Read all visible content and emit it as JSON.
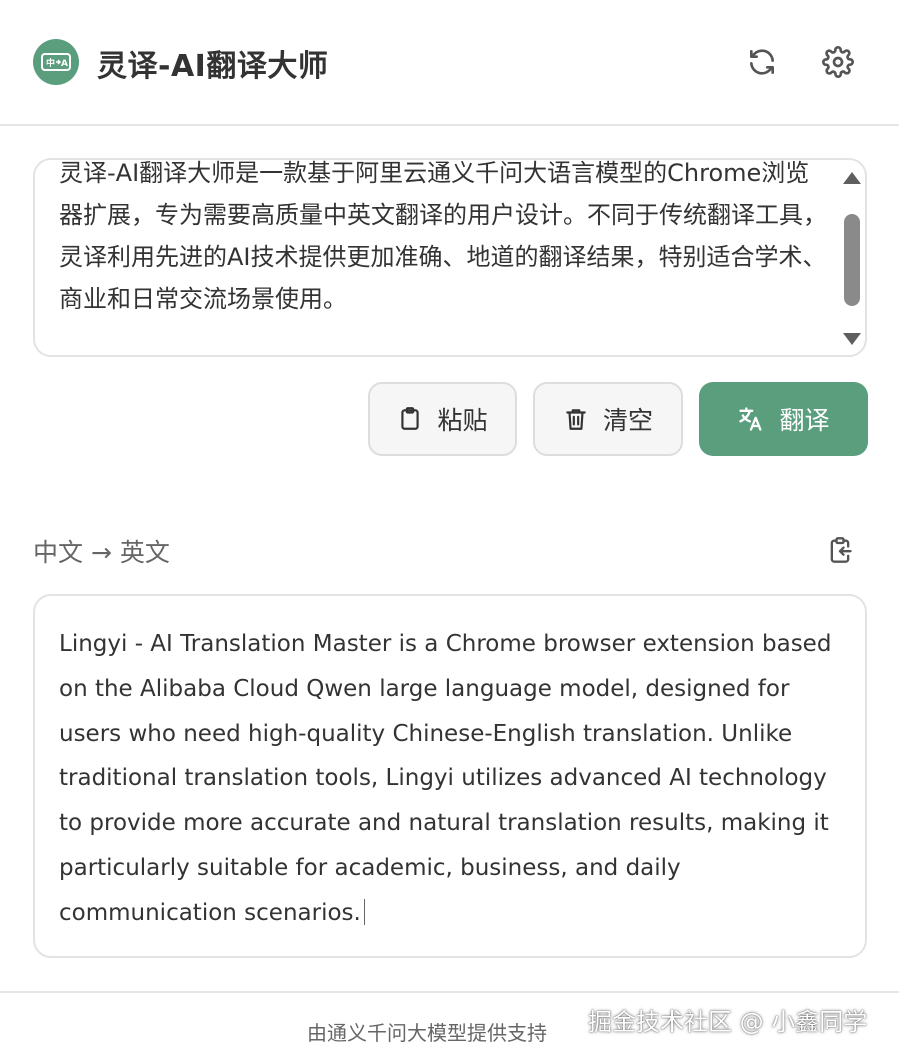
{
  "header": {
    "title": "灵译-AI翻译大师",
    "logo_icon": "translate-logo-icon",
    "refresh_icon": "refresh-icon",
    "settings_icon": "gear-icon"
  },
  "input": {
    "text": "灵译-AI翻译大师是一款基于阿里云通义千问大语言模型的Chrome浏览器扩展，专为需要高质量中英文翻译的用户设计。不同于传统翻译工具，灵译利用先进的AI技术提供更加准确、地道的翻译结果，特别适合学术、商业和日常交流场景使用。"
  },
  "actions": {
    "paste_label": "粘贴",
    "clear_label": "清空",
    "translate_label": "翻译"
  },
  "result": {
    "direction": "中文 → 英文",
    "copy_icon": "clipboard-copy-icon",
    "text": "Lingyi - AI Translation Master is a Chrome browser extension based on the Alibaba Cloud Qwen large language model, designed for users who need high-quality Chinese-English translation. Unlike traditional translation tools, Lingyi utilizes advanced AI technology to provide more accurate and natural translation results, making it particularly suitable for academic, business, and daily communication scenarios."
  },
  "footer": {
    "text": "由通义千问大模型提供支持"
  },
  "watermark": "掘金技术社区 @ 小鑫同学",
  "colors": {
    "accent": "#5a9e7e",
    "border": "#e3e3e3",
    "text": "#333333",
    "muted": "#666666"
  }
}
